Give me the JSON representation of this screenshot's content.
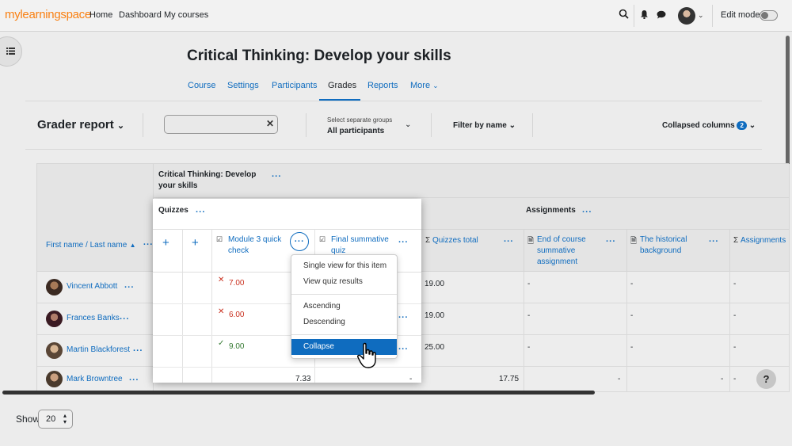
{
  "navbar": {
    "logo": "mylearningspace",
    "links": [
      "Home",
      "Dashboard",
      "My courses"
    ],
    "edit_mode_label": "Edit mode"
  },
  "course": {
    "title": "Critical Thinking: Develop your skills",
    "tabs": [
      "Course",
      "Settings",
      "Participants",
      "Grades",
      "Reports",
      "More"
    ]
  },
  "action_bar": {
    "report_title": "Grader report",
    "search_value": "",
    "groups_label": "Select separate groups",
    "groups_value": "All participants",
    "filter_label": "Filter by name",
    "collapsed_label": "Collapsed columns",
    "collapsed_count": "2"
  },
  "grid": {
    "course_header": "Critical Thinking: Develop your skills",
    "category_quizzes": "Quizzes",
    "category_assignments": "Assignments",
    "name_header": "First name / Last name",
    "columns": {
      "module3": "Module 3 quick check",
      "final_quiz": "Final summative quiz",
      "quizzes_total": "Quizzes total",
      "end_of_course": "End of course summative assignment",
      "historical": "The historical background",
      "assignments_total": "Assignments"
    },
    "students": [
      {
        "name": "Vincent Abbott",
        "module3": "7.00",
        "quizzes_total": "19.00",
        "end": "-",
        "hist": "-",
        "assign": "-"
      },
      {
        "name": "Frances Banks",
        "module3": "6.00",
        "quizzes_total": "19.00",
        "end": "-",
        "hist": "-",
        "assign": "-"
      },
      {
        "name": "Martin Blackforest",
        "module3": "9.00",
        "quizzes_total": "25.00",
        "end": "-",
        "hist": "-",
        "assign": "-"
      },
      {
        "name": "Mark Browntree",
        "module3": "7.33",
        "final_quiz": "-",
        "quizzes_total": "17.75",
        "end": "-",
        "hist": "-",
        "assign": "-"
      }
    ]
  },
  "context_menu": {
    "items": [
      "Single view for this item",
      "View quiz results",
      "Ascending",
      "Descending",
      "Collapse"
    ],
    "highlighted": "Collapse"
  },
  "footer": {
    "show_label": "Show",
    "show_value": "20"
  },
  "help": "?",
  "colors": {
    "accent": "#0f6cbf",
    "brand": "#f98012",
    "fail": "#ca3120",
    "pass": "#357a32"
  }
}
